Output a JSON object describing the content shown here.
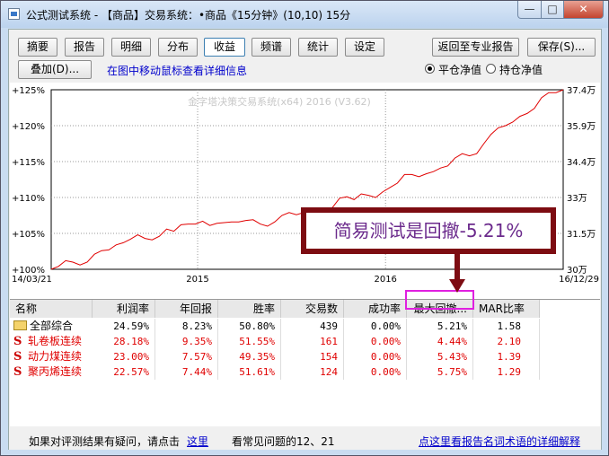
{
  "window": {
    "title": "公式测试系统 - 【商品】交易系统：•商品《15分钟》(10,10) 15分",
    "controls": {
      "minimize": "—",
      "maximize": "□",
      "close": "✕"
    }
  },
  "tabs": [
    {
      "label": "摘要"
    },
    {
      "label": "报告"
    },
    {
      "label": "明细"
    },
    {
      "label": "分布"
    },
    {
      "label": "收益",
      "active": true
    },
    {
      "label": "频谱"
    },
    {
      "label": "统计"
    },
    {
      "label": "设定"
    }
  ],
  "toolbar": {
    "back_label": "返回至专业报告",
    "save_label": "保存(S)...",
    "overlay_label": "叠加(D)...",
    "hint": "在图中移动鼠标查看详细信息",
    "radio_flat": "平仓净值",
    "radio_hold": "持仓净值"
  },
  "chart_data": {
    "type": "line",
    "watermark": "金字塔决策交易系统(x64) 2016 (V3.62)",
    "y_left_ticks": [
      "+125%",
      "+120%",
      "+115%",
      "+110%",
      "+105%",
      "+100%"
    ],
    "y_right_ticks": [
      "37.4万",
      "35.9万",
      "34.4万",
      "33万",
      "31.5万",
      "30万"
    ],
    "x_ticks": [
      "14/03/21",
      "2015",
      "2016",
      "16/12/29"
    ],
    "ylim": [
      100,
      125
    ],
    "line_color": "#e00000",
    "grid": "dotted",
    "values": [
      100.0,
      100.4,
      101.2,
      101.0,
      100.6,
      101.0,
      102.1,
      102.6,
      102.7,
      103.4,
      103.7,
      104.2,
      104.8,
      104.3,
      104.1,
      104.6,
      105.6,
      105.3,
      106.2,
      106.3,
      106.3,
      106.7,
      106.1,
      106.4,
      106.5,
      106.6,
      106.6,
      106.8,
      106.9,
      106.3,
      106.0,
      106.6,
      107.5,
      107.9,
      107.6,
      107.9,
      108.1,
      108.3,
      108.2,
      108.6,
      109.9,
      110.1,
      109.7,
      110.5,
      110.3,
      110.0,
      110.8,
      111.4,
      112.0,
      113.2,
      113.2,
      112.9,
      113.3,
      113.6,
      114.1,
      114.4,
      115.5,
      116.1,
      115.8,
      116.1,
      117.5,
      118.8,
      119.7,
      120.0,
      120.5,
      121.3,
      121.7,
      122.4,
      123.9,
      124.6,
      124.6,
      125.0
    ]
  },
  "callout": {
    "text": "简易测试是回撤-5.21%"
  },
  "table": {
    "headers": [
      "名称",
      "利润率",
      "年回报",
      "胜率",
      "交易数",
      "成功率",
      "最大回撤...",
      "MAR比率"
    ],
    "rows": [
      {
        "name": "全部综合",
        "kind": "total",
        "values": [
          "24.59%",
          "8.23%",
          "50.80%",
          "439",
          "0.00%",
          "5.21%",
          "1.58"
        ]
      },
      {
        "name": "轧卷板连续",
        "kind": "item",
        "values": [
          "28.18%",
          "9.35%",
          "51.55%",
          "161",
          "0.00%",
          "4.44%",
          "2.10"
        ]
      },
      {
        "name": "动力煤连续",
        "kind": "item",
        "values": [
          "23.00%",
          "7.57%",
          "49.35%",
          "154",
          "0.00%",
          "5.43%",
          "1.39"
        ]
      },
      {
        "name": "聚丙烯连续",
        "kind": "item",
        "values": [
          "22.57%",
          "7.44%",
          "51.61%",
          "124",
          "0.00%",
          "5.75%",
          "1.29"
        ]
      }
    ]
  },
  "status": {
    "prefix": "如果对评测结果有疑问，请点击",
    "link": "这里",
    "faq": "看常见问题的12、21",
    "glossary_link": "点这里看报告名词术语的详细解释"
  }
}
